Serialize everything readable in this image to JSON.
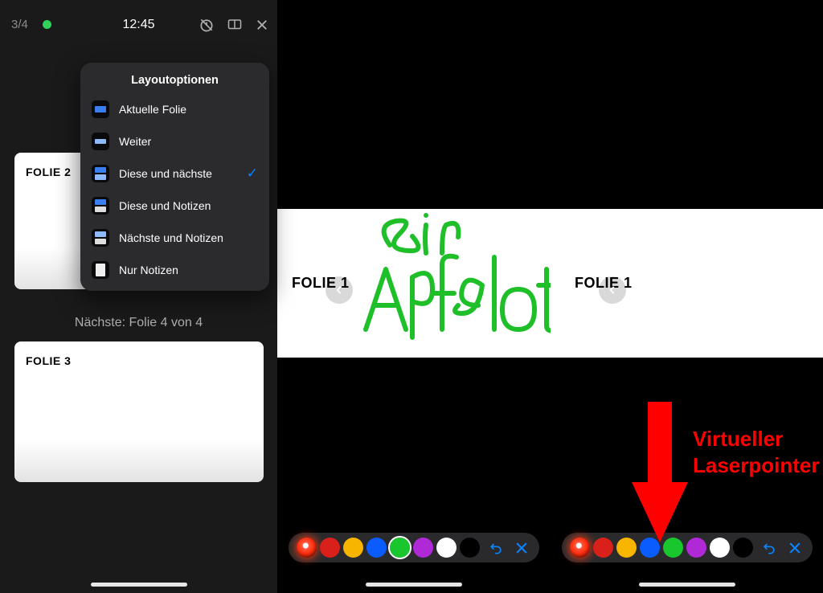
{
  "status": {
    "count": "3/4",
    "time": "12:45"
  },
  "popover": {
    "title": "Layoutoptionen",
    "options": [
      {
        "label": "Aktuelle Folie"
      },
      {
        "label": "Weiter"
      },
      {
        "label": "Diese und nächste"
      },
      {
        "label": "Diese und Notizen"
      },
      {
        "label": "Nächste und Notizen"
      },
      {
        "label": "Nur Notizen"
      }
    ],
    "selected_index": 2
  },
  "slides": {
    "card2": "FOLIE 2",
    "card3": "FOLIE 3",
    "next_caption": "Nächste: Folie 4 von 4",
    "strip_title": "FOLIE 1"
  },
  "handwriting_text": "Sir Apfelot",
  "palette": {
    "colors": [
      "#d9201a",
      "#f7b500",
      "#0a5cff",
      "#19c62e",
      "#b029d6",
      "#ffffff",
      "#000000"
    ]
  },
  "annotation": {
    "line1": "Virtueller",
    "line2": "Laserpointer"
  }
}
